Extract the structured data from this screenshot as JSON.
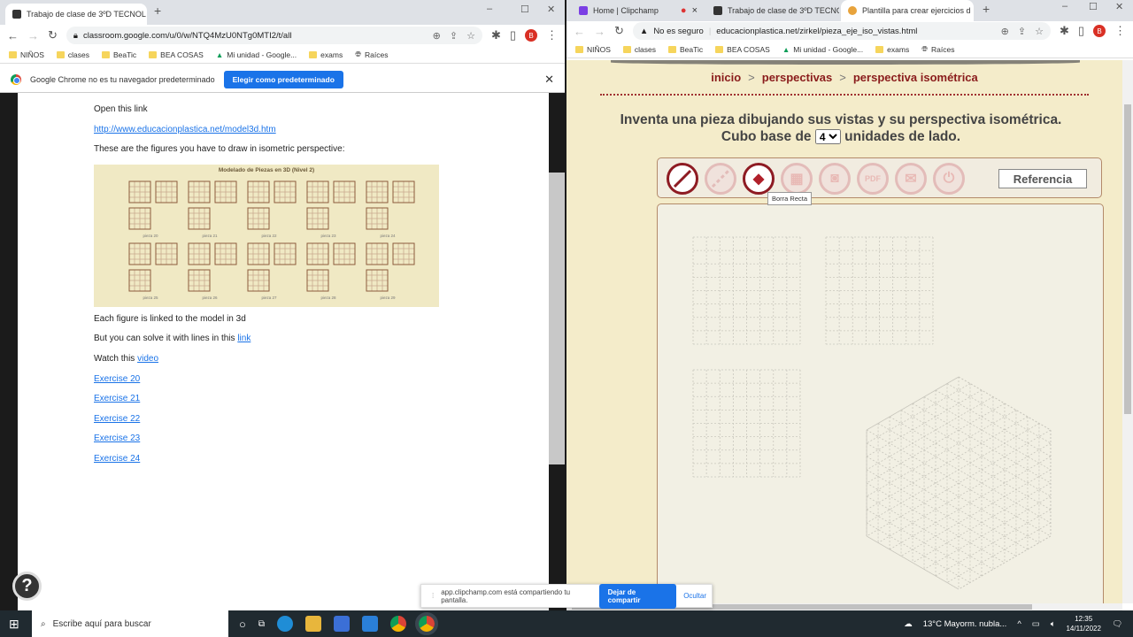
{
  "left_window": {
    "tab_title": "Trabajo de clase de 3ºD TECNOL",
    "url": "classroom.google.com/u/0/w/NTQ4MzU0NTg0MTI2/t/all",
    "avatar": "B",
    "bookmarks": [
      "NIÑOS",
      "clases",
      "BeaTic",
      "BEA COSAS",
      "Mi unidad - Google...",
      "exams",
      "Raíces"
    ],
    "infobar": {
      "message": "Google Chrome no es tu navegador predeterminado",
      "button": "Elegir como predeterminado"
    },
    "post": {
      "open_link": "Open this link",
      "model_link": "http://www.educacionplastica.net/model3d.htm",
      "figures_text": "These are the figures you have to draw in isometric perspective:",
      "figures_image_title": "Modelado de Piezas en 3D (Nivel 2)",
      "figure_labels": [
        "pieza 20",
        "pieza 21",
        "pieza 22",
        "pieza 23",
        "pieza 24",
        "pieza 25",
        "pieza 26",
        "pieza 27",
        "pieza 28",
        "pieza 29"
      ],
      "linked_text": "Each figure is linked to the model in 3d",
      "solve_text": "But you can solve it with lines in this ",
      "solve_link": "link",
      "watch_text": "Watch this ",
      "watch_link": "video",
      "exercises": [
        "Exercise 20",
        "Exercise 21",
        "Exercise 22",
        "Exercise 23",
        "Exercise 24"
      ]
    },
    "help": "?"
  },
  "right_window": {
    "tabs": [
      "Home | Clipchamp",
      "Trabajo de clase de 3ºD TECNOL",
      "Plantilla para crear ejercicios d"
    ],
    "security": "No es seguro",
    "url": "educacionplastica.net/zirkel/pieza_eje_iso_vistas.html",
    "avatar": "B",
    "bookmarks": [
      "NIÑOS",
      "clases",
      "BeaTic",
      "BEA COSAS",
      "Mi unidad - Google...",
      "exams",
      "Raíces"
    ],
    "breadcrumb": [
      "inicio",
      "perspectivas",
      "perspectiva isométrica"
    ],
    "breadcrumb_sep": ">",
    "heading_before": "Inventa una pieza dibujando sus vistas y su perspectiva isométrica. Cubo base de",
    "cube_size": "4",
    "heading_after": "unidades de lado.",
    "tools": [
      "Dibuja Recta",
      "Recta discontinua",
      "Borra Recta",
      "Vistas",
      "Captura",
      "PDF",
      "Enviar",
      "Salir"
    ],
    "tooltip": "Borra Recta",
    "reference_button": "Referencia"
  },
  "share_bar": {
    "message": "app.clipchamp.com está compartiendo tu pantalla.",
    "stop": "Dejar de compartir",
    "hide": "Ocultar"
  },
  "taskbar": {
    "search_placeholder": "Escribe aquí para buscar",
    "weather": "13°C  Mayorm. nubla...",
    "time": "12:35",
    "date": "14/11/2022"
  }
}
